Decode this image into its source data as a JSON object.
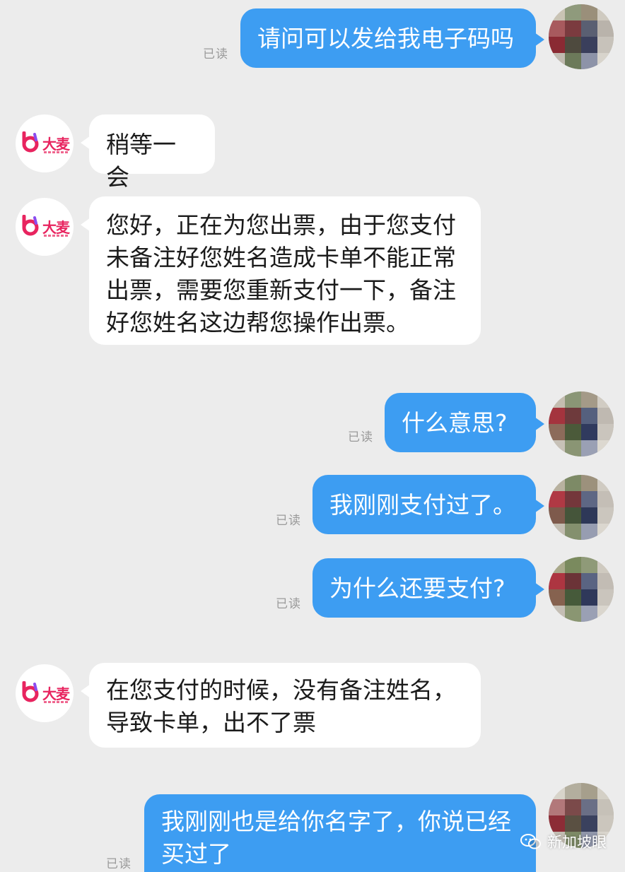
{
  "status": {
    "read_label": "已读"
  },
  "contact": {
    "brand_name": "大麦"
  },
  "messages": [
    {
      "side": "out",
      "text": "请问可以发给我电子码吗",
      "read": true
    },
    {
      "side": "in",
      "text": "稍等一会"
    },
    {
      "side": "in",
      "lines": [
        "您好，正在为您出票，由于您支付",
        "未备注好您姓名造成卡单不能正常",
        "出票，需要您重新支付一下，备注",
        "好您姓名这边帮您操作出票。"
      ]
    },
    {
      "side": "out",
      "text": "什么意思?",
      "read": true
    },
    {
      "side": "out",
      "text": "我刚刚支付过了。",
      "read": true
    },
    {
      "side": "out",
      "text": "为什么还要支付?",
      "read": true
    },
    {
      "side": "in",
      "lines": [
        "在您支付的时候，没有备注姓名，",
        "导致卡单，出不了票"
      ]
    },
    {
      "side": "out",
      "lines": [
        "我刚刚也是给你名字了，你说已经",
        "买过了"
      ],
      "read": true
    }
  ],
  "watermark": {
    "text": "新加坡眼"
  },
  "colors": {
    "outgoing_bubble": "#3d9df2",
    "incoming_bubble": "#ffffff",
    "background": "#ececec",
    "brand": "#e8245f"
  }
}
